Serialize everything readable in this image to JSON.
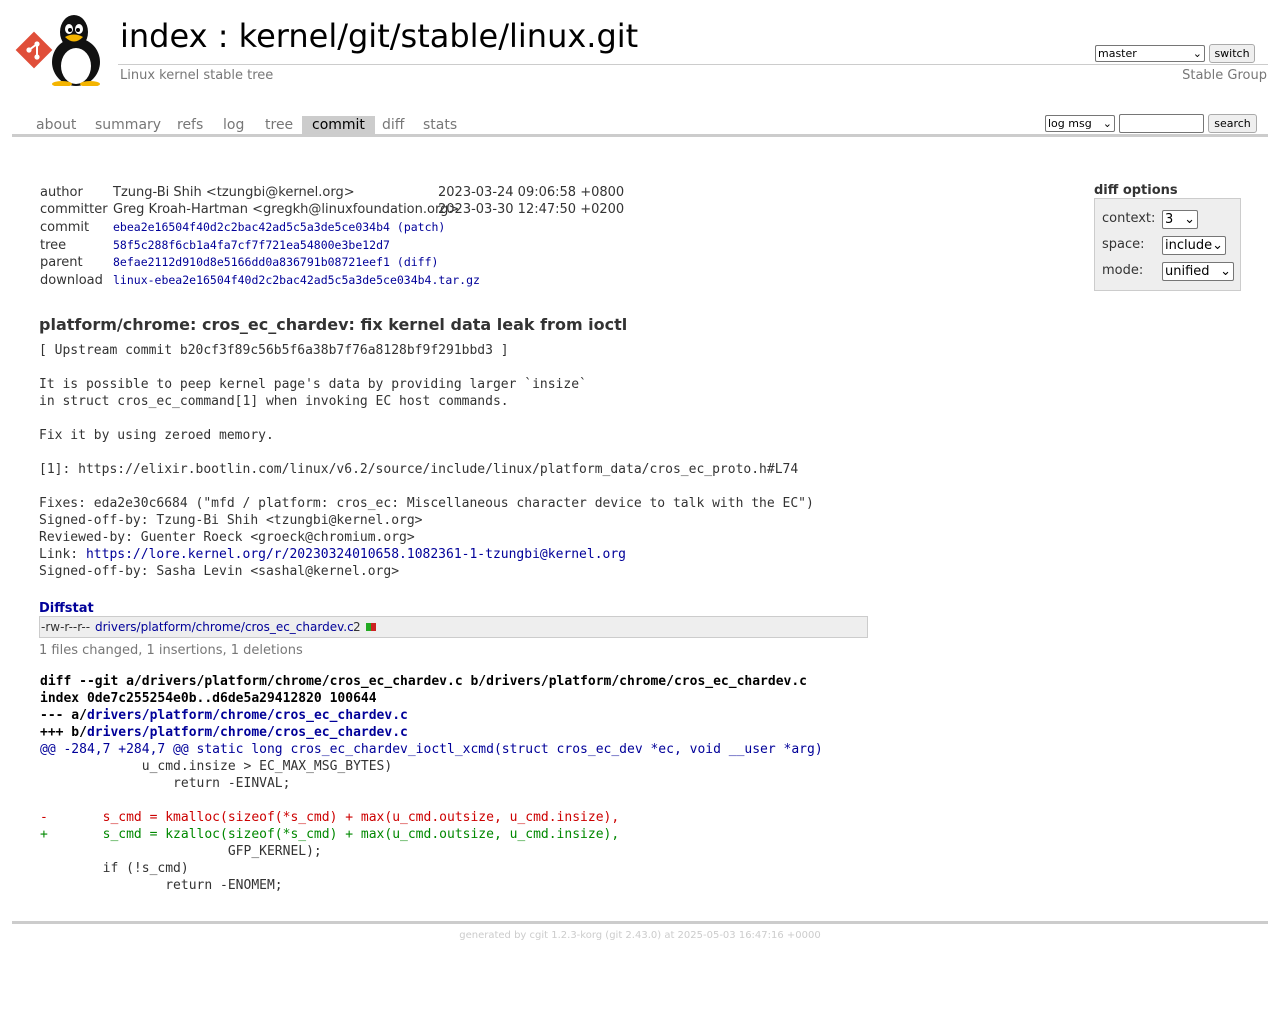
{
  "header": {
    "index_link": "index",
    "separator": " : ",
    "repo_path": "kernel/git/stable/linux.git",
    "description": "Linux kernel stable tree",
    "owner": "Stable Group",
    "branch_selected": "master",
    "switch_label": "switch"
  },
  "tabs": [
    {
      "label": "about"
    },
    {
      "label": "summary"
    },
    {
      "label": "refs"
    },
    {
      "label": "log"
    },
    {
      "label": "tree"
    },
    {
      "label": "commit",
      "active": true
    },
    {
      "label": "diff"
    },
    {
      "label": "stats"
    }
  ],
  "search": {
    "mode_selected": "log msg",
    "query": "",
    "button": "search"
  },
  "commit_info": {
    "author_label": "author",
    "author": "Tzung-Bi Shih <tzungbi@kernel.org>",
    "author_date": "2023-03-24 09:06:58 +0800",
    "committer_label": "committer",
    "committer": "Greg Kroah-Hartman <gregkh@linuxfoundation.org>",
    "committer_date": "2023-03-30 12:47:50 +0200",
    "commit_label": "commit",
    "commit": "ebea2e16504f40d2c2bac42ad5c5a3de5ce034b4",
    "patch_link": "(patch)",
    "tree_label": "tree",
    "tree": "58f5c288f6cb1a4fa7cf7f721ea54800e3be12d7",
    "parent_label": "parent",
    "parent": "8efae2112d910d8e5166dd0a836791b08721eef1",
    "diff_link": "(diff)",
    "download_label": "download",
    "download": "linux-ebea2e16504f40d2c2bac42ad5c5a3de5ce034b4.tar.gz"
  },
  "diff_options": {
    "title": "diff options",
    "context_label": "context:",
    "context_value": "3",
    "space_label": "space:",
    "space_value": "include",
    "mode_label": "mode:",
    "mode_value": "unified"
  },
  "message": {
    "subject": "platform/chrome: cros_ec_chardev: fix kernel data leak from ioctl",
    "lines": [
      "[ Upstream commit b20cf3f89c56b5f6a38b7f76a8128bf9f291bbd3 ]",
      "",
      "It is possible to peep kernel page's data by providing larger `insize`",
      "in struct cros_ec_command[1] when invoking EC host commands.",
      "",
      "Fix it by using zeroed memory.",
      "",
      "[1]: https://elixir.bootlin.com/linux/v6.2/source/include/linux/platform_data/cros_ec_proto.h#L74",
      "",
      "Fixes: eda2e30c6684 (\"mfd / platform: cros_ec: Miscellaneous character device to talk with the EC\")",
      "Signed-off-by: Tzung-Bi Shih <tzungbi@kernel.org>",
      "Reviewed-by: Guenter Roeck <groeck@chromium.org>"
    ],
    "link_prefix": "Link: ",
    "link_url": "https://lore.kernel.org/r/20230324010658.1082361-1-tzungbi@kernel.org",
    "last_line": "Signed-off-by: Sasha Levin <sashal@kernel.org>"
  },
  "diffstat": {
    "header": "Diffstat",
    "mode": "-rw-r--r--",
    "file": "drivers/platform/chrome/cros_ec_chardev.c",
    "count": "2",
    "insertions_ratio": 0.5,
    "deletions_ratio": 0.5,
    "summary": "1 files changed, 1 insertions, 1 deletions"
  },
  "diff": {
    "git_line": "diff --git a/drivers/platform/chrome/cros_ec_chardev.c b/drivers/platform/chrome/cros_ec_chardev.c",
    "index_line": "index 0de7c255254e0b..d6de5a29412820 100644",
    "minus_prefix": "--- a/",
    "plus_prefix": "+++ b/",
    "file_path": "drivers/platform/chrome/cros_ec_chardev.c",
    "hunk": "@@ -284,7 +284,7 @@ static long cros_ec_chardev_ioctl_xcmd(struct cros_ec_dev *ec, void __user *arg)",
    "lines": [
      {
        "type": "ctx",
        "text": "             u_cmd.insize > EC_MAX_MSG_BYTES)"
      },
      {
        "type": "ctx",
        "text": "                 return -EINVAL;"
      },
      {
        "type": "ctx",
        "text": ""
      },
      {
        "type": "del",
        "text": "-       s_cmd = kmalloc(sizeof(*s_cmd) + max(u_cmd.outsize, u_cmd.insize),"
      },
      {
        "type": "add",
        "text": "+       s_cmd = kzalloc(sizeof(*s_cmd) + max(u_cmd.outsize, u_cmd.insize),"
      },
      {
        "type": "ctx",
        "text": "                        GFP_KERNEL);"
      },
      {
        "type": "ctx",
        "text": "        if (!s_cmd)"
      },
      {
        "type": "ctx",
        "text": "                return -ENOMEM;"
      }
    ]
  },
  "footer": "generated by cgit 1.2.3-korg (git 2.43.0) at 2025-05-03 16:47:16 +0000",
  "colors": {
    "insertion": "#22aa22",
    "deletion": "#cc2222",
    "link": "#000099"
  }
}
